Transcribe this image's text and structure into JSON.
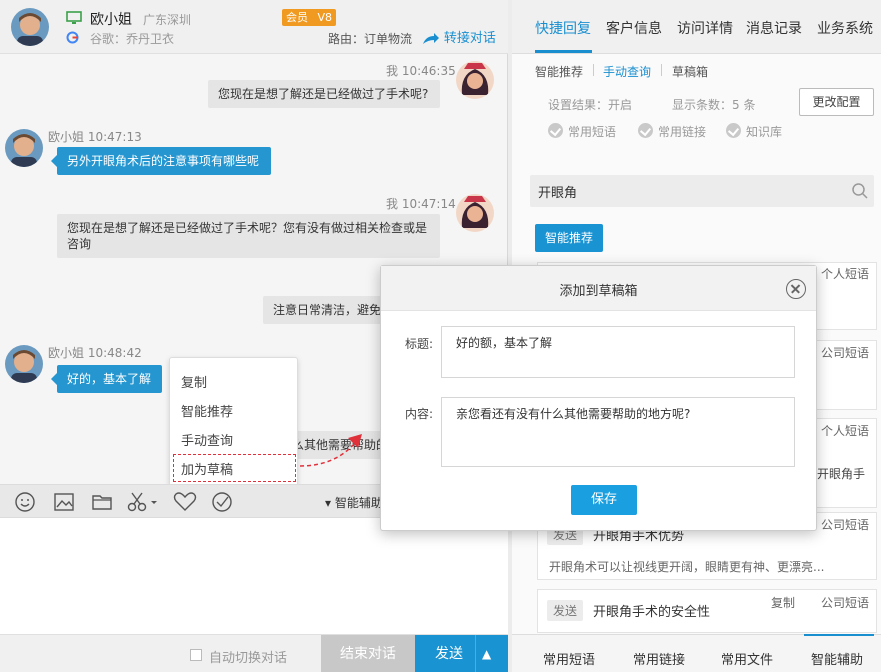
{
  "customer": {
    "name": "欧小姐",
    "location": "广东深圳",
    "source": "谷歌：乔丹卫衣",
    "vip_badge": "会员",
    "vip_level": "V8",
    "route": "路由：订单物流",
    "transfer": "转接对话"
  },
  "messages": [
    {
      "meta": "我 10:46:35",
      "text": "您现在是想了解还是已经做过了手术呢?"
    },
    {
      "meta": "欧小姐 10:47:13",
      "text": "另外开眼角术后的注意事项有哪些呢"
    },
    {
      "meta": "我 10:47:14",
      "line1": "您现在是想了解还是已经做过了手术呢？您有没有做过相关检查或是",
      "line2": "咨询"
    },
    {
      "text": "注意日常清洁，避免"
    },
    {
      "meta": "欧小姐 10:48:42",
      "text": "好的，基本了解"
    },
    {
      "text": "么其他需要帮助的"
    }
  ],
  "context_menu": {
    "items": [
      "复制",
      "智能推荐",
      "手动查询",
      "加为草稿"
    ]
  },
  "toolbar": {
    "smart_assist": "▾ 智能辅助"
  },
  "bottom": {
    "auto_switch": "自动切换对话",
    "end": "结束对话",
    "send": "发送",
    "send_arrow": "▲"
  },
  "right_tabs": [
    "快捷回复",
    "客户信息",
    "访问详情",
    "消息记录",
    "业务系统"
  ],
  "subtabs": [
    "智能推荐",
    "手动查询",
    "草稿箱"
  ],
  "settings": {
    "result": "设置结果：开启",
    "count": "显示条数：5  条",
    "config_btn": "更改配置",
    "checks": [
      "常用短语",
      "常用链接",
      "知识库"
    ]
  },
  "search": {
    "value": "开眼角"
  },
  "smart_btn": "智能推荐",
  "cards": [
    {
      "tag": "个人短语"
    },
    {
      "tag": "公司短语"
    },
    {
      "tag": "个人短语",
      "snippet": "开眼角手"
    },
    {
      "tag": "公司短语",
      "send": "发送",
      "title": "开眼角手术优势",
      "body": "开眼角术可以让视线更开阔，眼睛更有神、更漂亮..."
    },
    {
      "tag": "公司短语",
      "copy": "复制",
      "send": "发送",
      "title": "开眼角手术的安全性"
    }
  ],
  "right_bottom_tabs": [
    "常用短语",
    "常用链接",
    "常用文件",
    "智能辅助"
  ],
  "modal": {
    "title": "添加到草稿箱",
    "title_label": "标题:",
    "title_value": "好的额，基本了解",
    "content_label": "内容:",
    "content_value": "亲您看还有没有什么其他需要帮助的地方呢?",
    "save": "保存"
  }
}
